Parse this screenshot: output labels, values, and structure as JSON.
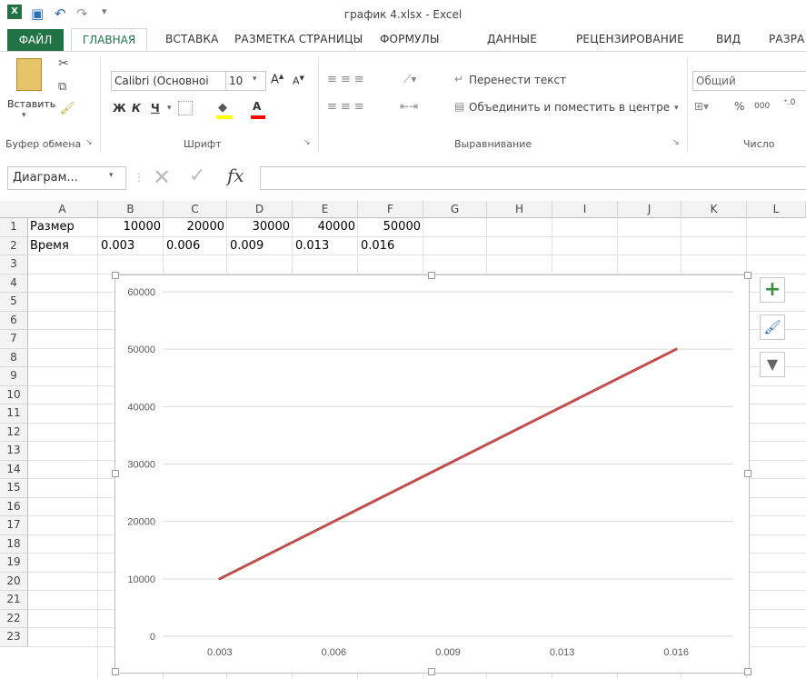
{
  "window": {
    "title": "график 4.xlsx - Excel"
  },
  "ribbon_tabs": [
    "ФАЙЛ",
    "ГЛАВНАЯ",
    "ВСТАВКА",
    "РАЗМЕТКА СТРАНИЦЫ",
    "ФОРМУЛЫ",
    "ДАННЫЕ",
    "РЕЦЕНЗИРОВАНИЕ",
    "ВИД",
    "РАЗРА"
  ],
  "ribbon": {
    "paste_label": "Вставить",
    "clipboard_group": "Буфер обмена",
    "font_name": "Calibri (Основноі",
    "font_size": "10",
    "bold": "Ж",
    "italic": "К",
    "underline": "Ч",
    "font_group": "Шрифт",
    "wrap_text": "Перенести текст",
    "merge_center": "Объединить и поместить в центре",
    "alignment_group": "Выравнивание",
    "number_format": "Общий",
    "percent": "%",
    "thousands": "000",
    "number_group": "Число"
  },
  "formula_bar": {
    "name_box": "Диаграм...",
    "fx": "fx",
    "formula": ""
  },
  "columns": [
    "A",
    "B",
    "C",
    "D",
    "E",
    "F",
    "G",
    "H",
    "I",
    "J",
    "K",
    "L"
  ],
  "rows": [
    "1",
    "2",
    "3",
    "4",
    "5",
    "6",
    "7",
    "8",
    "9",
    "10",
    "11",
    "12",
    "13",
    "14",
    "15",
    "16",
    "17",
    "18",
    "19",
    "20",
    "21",
    "22",
    "23"
  ],
  "cells": {
    "A1": "Размер",
    "B1": "10000",
    "C1": "20000",
    "D1": "30000",
    "E1": "40000",
    "F1": "50000",
    "A2": "Время",
    "B2": "0.003",
    "C2": "0.006",
    "D2": "0.009",
    "E2": "0.013",
    "F2": "0.016"
  },
  "chart_data": {
    "type": "line",
    "categories": [
      "0.003",
      "0.006",
      "0.009",
      "0.013",
      "0.016"
    ],
    "series": [
      {
        "values": [
          10000,
          20000,
          30000,
          40000,
          50000
        ],
        "color": "#c0504d"
      }
    ],
    "y_ticks": [
      "0",
      "10000",
      "20000",
      "30000",
      "40000",
      "50000",
      "60000"
    ],
    "ylim": [
      0,
      60000
    ],
    "gridlines": true
  },
  "colors": {
    "excel_green": "#217346",
    "line": "#c0504d"
  }
}
